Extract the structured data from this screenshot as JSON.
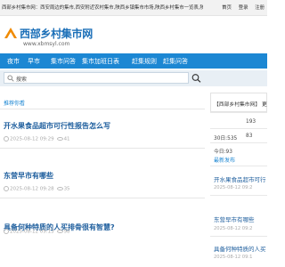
{
  "topbar": {
    "text": "西部乡村集市网：西安周边的集市,西安附近农村集市,陕西乡镇集市市场,陕西乡村集市一览表,陕西各个乡村集市",
    "links": [
      "首页",
      "登录",
      "注册"
    ]
  },
  "logo": {
    "title": "西部乡村集市网",
    "subtitle": "www.xbmsyl.com"
  },
  "nav": {
    "items": [
      "夜市",
      "早市",
      "集市问答",
      "集市加班日表",
      "赶集规则",
      "赶集问答"
    ]
  },
  "search": {
    "placeholder": "搜索"
  },
  "main": {
    "section_title": "推荐你看",
    "articles": [
      {
        "title": "开水果食品超市可行性报告怎么写",
        "date": "2025-08-12 09:29",
        "views": "41"
      },
      {
        "title": "东营早市有哪些",
        "date": "2025-08-12 09:28",
        "views": "35"
      },
      {
        "title": "具备何种特质的人买排骨很有智慧?",
        "date": "2025-08-12 09:13",
        "views": "98"
      }
    ]
  },
  "sidebar": {
    "site_name": "【西部乡村集市网】 更",
    "stats": {
      "row1_value": "193",
      "row2_label": "30日:535",
      "row2_value": "83",
      "row3_label": "今日:93"
    },
    "latest_title": "最新发布",
    "latest": [
      {
        "title": "开水果食品超市可行",
        "date": "2025-08-12 09:2"
      },
      {
        "title": "东营早市有哪些",
        "date": "2025-08-12 09:2"
      },
      {
        "title": "具备何种特质的人买",
        "date": "2025-08-12 09:1"
      }
    ]
  },
  "colors": {
    "nav_bg": "#1c87d3",
    "title_blue": "#1f5f9e",
    "accent": "#1c87d3"
  }
}
